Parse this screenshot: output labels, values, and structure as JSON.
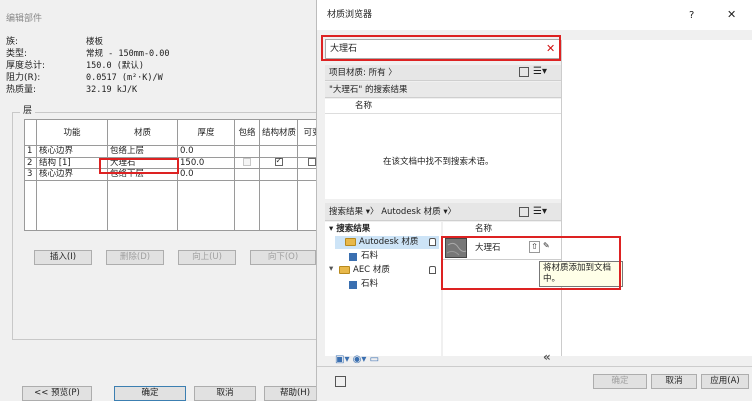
{
  "left_dialog": {
    "title": "编辑部件",
    "props": [
      {
        "label": "族:",
        "value": "楼板"
      },
      {
        "label": "类型:",
        "value": "常规 - 150mm-0.00"
      },
      {
        "label": "厚度总计:",
        "value": "150.0 (默认)"
      },
      {
        "label": "阻力(R):",
        "value": "0.0517 (m²·K)/W"
      },
      {
        "label": "热质量:",
        "value": "32.19 kJ/K"
      }
    ],
    "layers_group_label": "层",
    "table": {
      "headers": [
        "",
        "功能",
        "材质",
        "厚度",
        "包络",
        "结构材质",
        "可变"
      ],
      "rows": [
        {
          "num": "1",
          "function": "核心边界",
          "material": "包络上层",
          "thickness": "0.0",
          "bold": true
        },
        {
          "num": "2",
          "function": "结构 [1]",
          "material": "大理石",
          "thickness": "150.0",
          "bold": false
        },
        {
          "num": "3",
          "function": "核心边界",
          "material": "包络下层",
          "thickness": "0.0",
          "bold": true
        }
      ]
    },
    "buttons": {
      "insert": "插入(I)",
      "delete": "删除(D)",
      "up": "向上(U)",
      "down": "向下(O)",
      "preview": "<< 预览(P)",
      "ok": "确定",
      "cancel": "取消",
      "help": "帮助(H)"
    }
  },
  "material_browser": {
    "title": "材质浏览器",
    "help_label": "?",
    "close_label": "✕",
    "search": {
      "value": "大理石",
      "clear_label": "✕"
    },
    "project_filter": "项目材质: 所有",
    "search_results_caption": "\"大理石\" 的搜索结果",
    "name_header": "名称",
    "not_found_message": "在该文档中找不到搜索术语。",
    "library_breadcrumb": {
      "first": "搜索结果",
      "second": "Autodesk 材质"
    },
    "tree": {
      "root": "搜索结果",
      "items": [
        {
          "label": "Autodesk 材质",
          "child": "石料"
        },
        {
          "label": "AEC 材质",
          "child": "石料"
        }
      ]
    },
    "library_result": {
      "header": "名称",
      "name": "大理石"
    },
    "tooltip": "将材质添加到文档中。",
    "bottom_buttons": {
      "ok": "确定",
      "cancel": "取消",
      "apply": "应用(A)"
    },
    "collapse_label": "«"
  }
}
